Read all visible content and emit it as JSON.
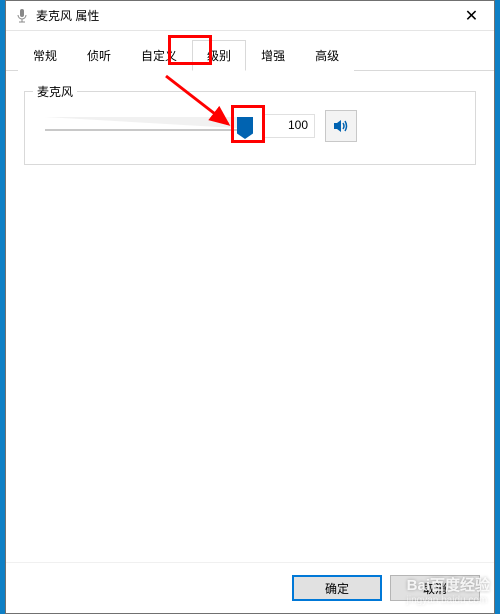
{
  "window": {
    "title": "麦克风 属性",
    "close_glyph": "✕"
  },
  "tabs": [
    {
      "label": "常规"
    },
    {
      "label": "侦听"
    },
    {
      "label": "自定义"
    },
    {
      "label": "级别",
      "active": true
    },
    {
      "label": "增强"
    },
    {
      "label": "高级"
    }
  ],
  "microphone": {
    "group_label": "麦克风",
    "level_value": "100",
    "slider_percent": 100
  },
  "buttons": {
    "ok": "确定",
    "cancel": "取消"
  },
  "watermark": {
    "brand": "Bai百度经验",
    "url": "jingyan.baidu.com"
  },
  "colors": {
    "highlight": "#ff0000",
    "accent": "#0063b1"
  }
}
